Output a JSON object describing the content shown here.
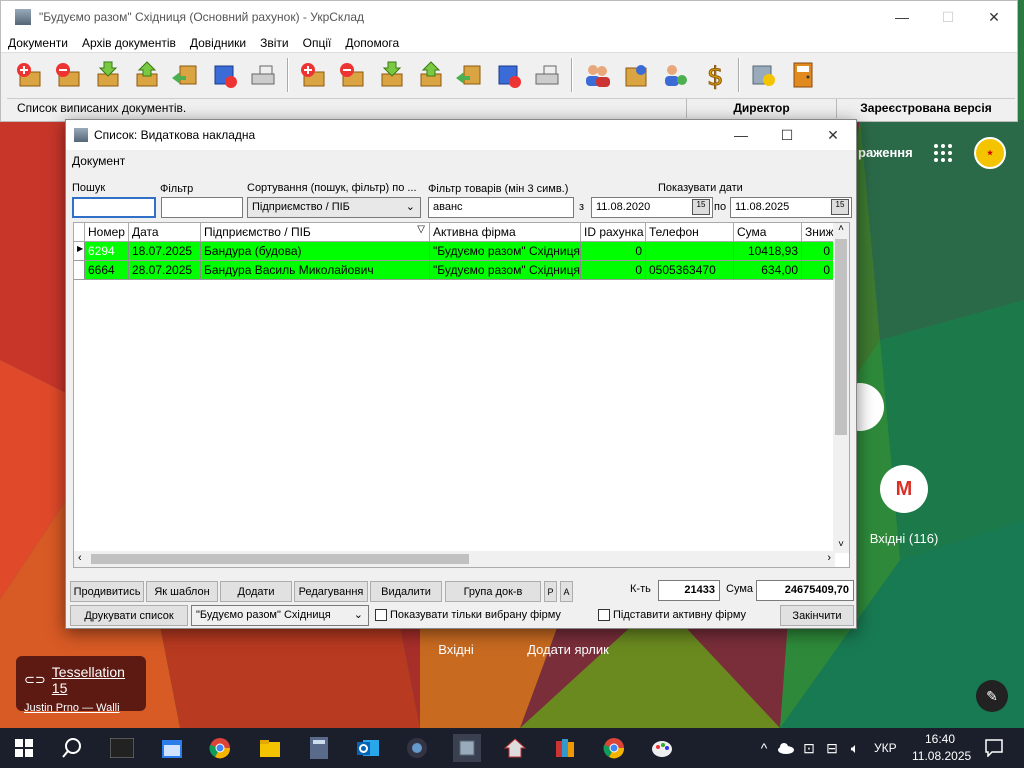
{
  "app": {
    "title": "\"Будуємо разом\" Східниця (Основний рахунок) - УкрСклад",
    "menu": [
      "Документи",
      "Архів документів",
      "Довідники",
      "Звіти",
      "Опції",
      "Допомога"
    ],
    "status": {
      "left": "Список виписаних документів.",
      "user": "Директор",
      "version": "Зареєстрована версія"
    }
  },
  "dialog": {
    "title": "Список: Видаткова накладна",
    "menu": "Документ",
    "labels": {
      "search": "Пошук",
      "filter": "Фільтр",
      "sort": "Сортування (пошук, фільтр) по ...",
      "goods_filter": "Фільтр товарів (мін 3 симв.)",
      "show_dates": "Показувати дати",
      "from": "з",
      "to": "по"
    },
    "values": {
      "search": "",
      "filter": "",
      "sort": "Підприємство / ПІБ",
      "goods_filter": "аванс",
      "date_from": "11.08.2020",
      "date_to": "11.08.2025"
    },
    "table": {
      "columns": [
        "Номер",
        "Дата",
        "Підприємство / ПІБ",
        "Активна фірма",
        "ID рахунка",
        "Телефон",
        "Сума",
        "Зниж"
      ],
      "rows": [
        [
          "6294",
          "18.07.2025",
          "Бандура (будова)",
          "\"Будуємо разом\" Східниця",
          "0",
          "",
          "10418,93",
          "0"
        ],
        [
          "6664",
          "28.07.2025",
          "Бандура Василь Миколайович",
          "\"Будуємо разом\" Східниця",
          "0",
          "0505363470",
          "634,00",
          "0"
        ]
      ]
    },
    "buttons": {
      "continue": "Продивитись",
      "template": "Як шаблон",
      "add": "Додати",
      "edit": "Редагування",
      "delete": "Видалити",
      "group": "Група док-в",
      "p": "P",
      "a": "A",
      "print": "Друкувати список",
      "finish": "Закінчити"
    },
    "count_label": "К-ть",
    "count": "21433",
    "sum_label": "Сума",
    "sum": "24675409,70",
    "firm": "\"Будуємо разом\" Східниця",
    "chk_show_selected": "Показувати тільки вибрану фірму",
    "chk_active_firm": "Підставити активну фірму"
  },
  "desktop": {
    "partial_label": "раження",
    "gmail_label": "Вхідні (116)",
    "inbox": "Вхідні",
    "add_shortcut": "Додати ярлик",
    "wallpaper_title": "Tessellation 15",
    "wallpaper_author": "Justin Prno — Walli"
  },
  "taskbar": {
    "lang": "УКР",
    "time": "16:40",
    "date": "11.08.2025"
  }
}
